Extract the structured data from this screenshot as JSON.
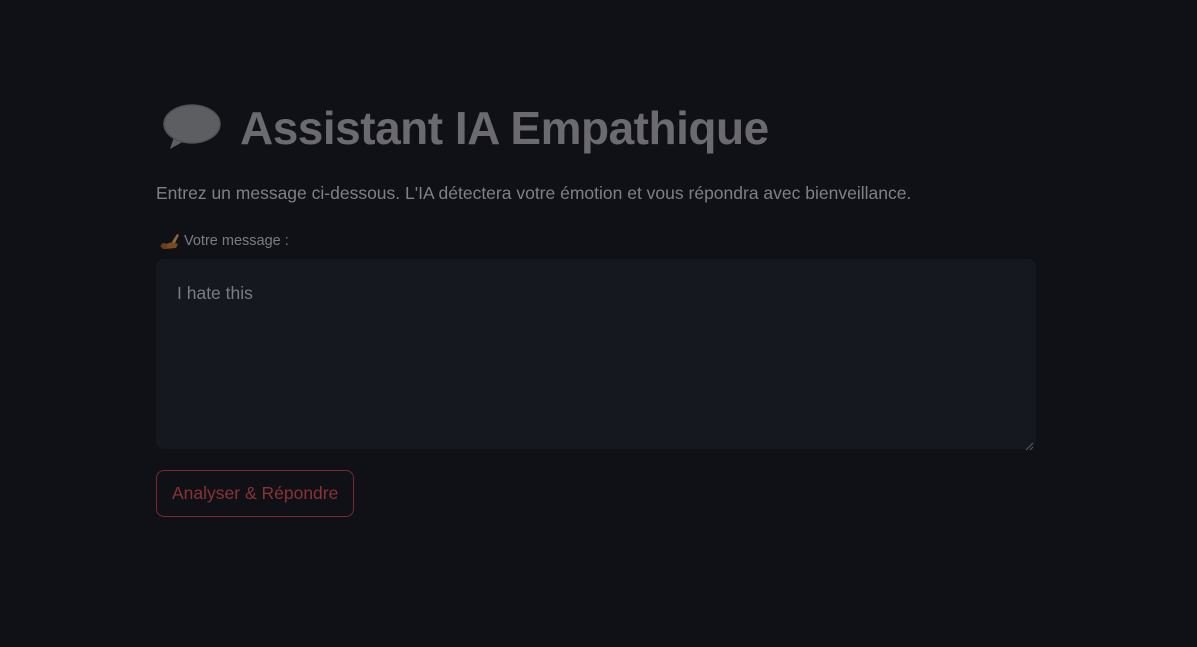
{
  "page": {
    "title": "Assistant IA Empathique",
    "title_icon": "speech-bubble-icon",
    "subtitle": "Entrez un message ci-dessous. L'IA détectera votre émotion et vous répondra avec bienveillance."
  },
  "form": {
    "message_label": "Votre message :",
    "message_label_icon": "writing-hand-icon",
    "message_value": "I hate this",
    "submit_label": "Analyser & Répondre"
  },
  "colors": {
    "background": "#0f1117",
    "input_background": "#16181f",
    "accent": "#7a2a2e",
    "title_text": "#6a6a6f"
  }
}
